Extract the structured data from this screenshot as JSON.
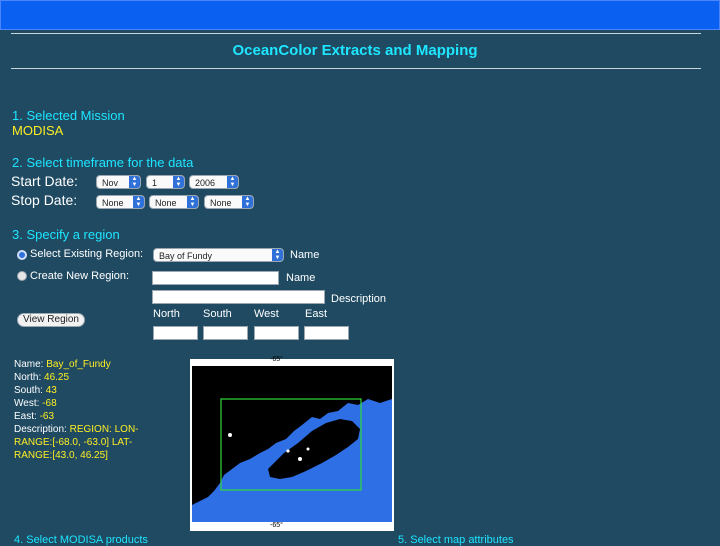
{
  "page": {
    "title": "OceanColor Extracts and Mapping"
  },
  "mission": {
    "heading": "1. Selected Mission",
    "value": "MODISA"
  },
  "timeframe": {
    "heading": "2. Select timeframe for the data",
    "start_label": "Start Date",
    "stop_label": "Stop Date",
    "colon": ":",
    "start": {
      "month": "Nov",
      "day": "1",
      "year": "2006"
    },
    "stop": {
      "month": "None",
      "day": "None",
      "year": "None"
    }
  },
  "region": {
    "heading": "3. Specify a region",
    "existing_label": "Select Existing Region:",
    "existing_value": "Bay of Fundy",
    "name_label": "Name",
    "new_label": "Create New Region:",
    "new_name_label": "Name",
    "description_label": "Description",
    "north_label": "North",
    "south_label": "South",
    "west_label": "West",
    "east_label": "East",
    "view_button": "View Region"
  },
  "region_info": {
    "name_key": "Name:",
    "name_val": "Bay_of_Fundy",
    "north_key": "North:",
    "north_val": "46.25",
    "south_key": "South:",
    "south_val": "43",
    "west_key": "West:",
    "west_val": "-68",
    "east_key": "East:",
    "east_val": "-63",
    "desc_key": "Description:",
    "desc_val": "REGION: LON-RANGE:[-68.0, -63.0] LAT-RANGE:[43.0, 46.25]"
  },
  "map": {
    "top_tick": "-65°",
    "bottom_tick": "-65°",
    "colors": {
      "land": "#000000",
      "water": "#2e6fe6",
      "box": "#2edc3a"
    }
  },
  "footer": {
    "left": "4. Select MODISA products",
    "right": "5. Select map attributes"
  },
  "colors": {
    "background": "#1f4a62",
    "heading": "#1ee6ff",
    "value": "#ffee22",
    "topbar": "#0a60f0"
  }
}
